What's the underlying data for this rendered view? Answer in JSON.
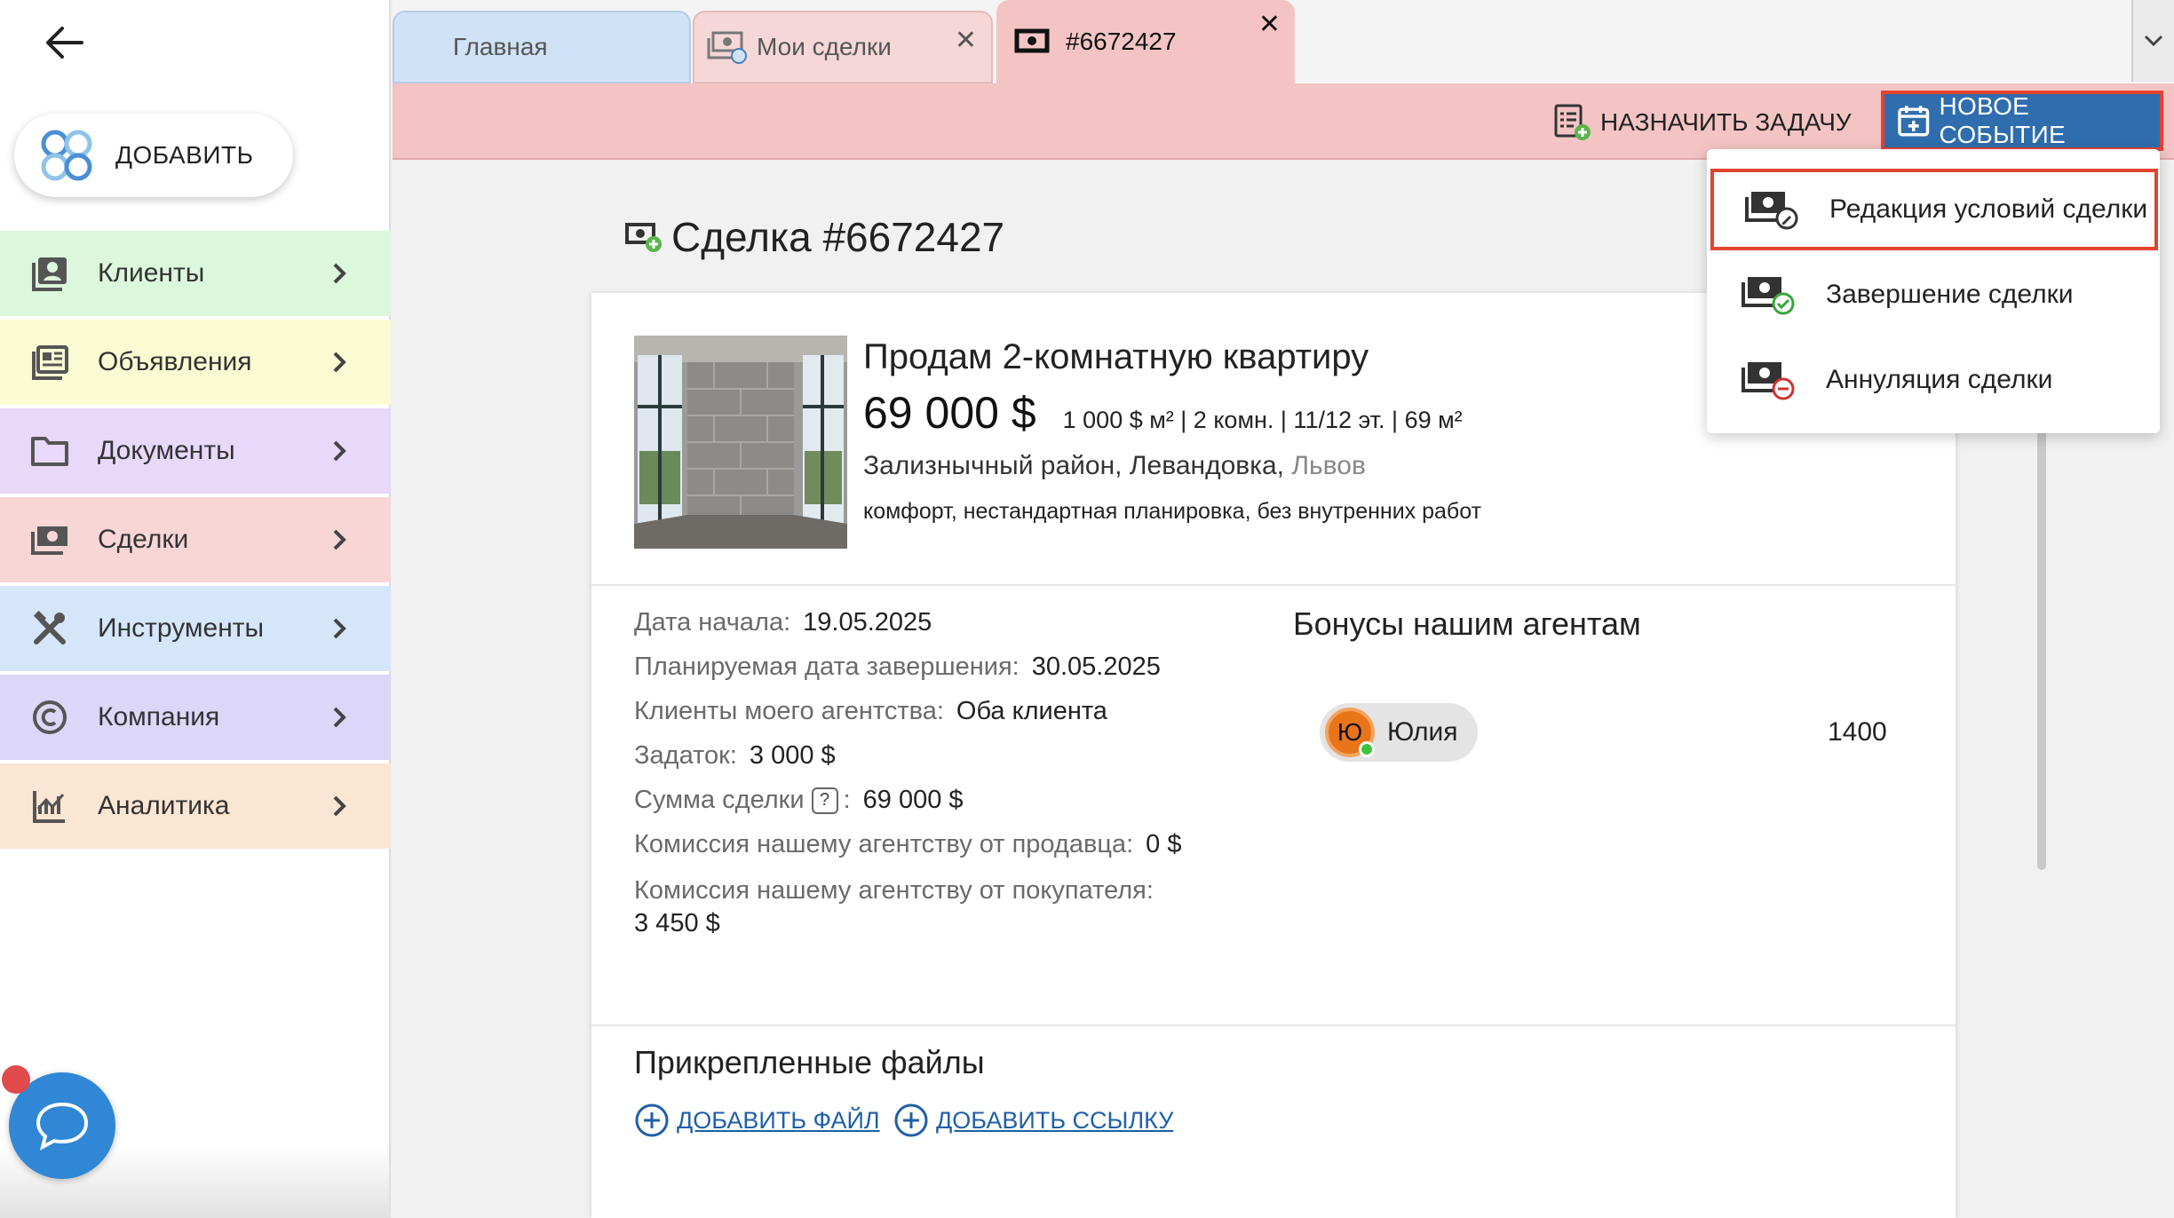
{
  "sidebar": {
    "add_label": "ДОБАВИТЬ",
    "items": [
      {
        "label": "Клиенты",
        "bg": "#dcf8dc",
        "icon": "clients-icon"
      },
      {
        "label": "Объявления",
        "bg": "#fbfbd3",
        "icon": "listings-icon"
      },
      {
        "label": "Документы",
        "bg": "#e8d8fa",
        "icon": "folder-icon"
      },
      {
        "label": "Сделки",
        "bg": "#f8d6d6",
        "icon": "deals-money-icon"
      },
      {
        "label": "Инструменты",
        "bg": "#d5e6fb",
        "icon": "tools-icon"
      },
      {
        "label": "Компания",
        "bg": "#dcd6f8",
        "icon": "copyright-icon"
      },
      {
        "label": "Аналитика",
        "bg": "#fbe5d3",
        "icon": "analytics-icon"
      }
    ]
  },
  "tabs": [
    {
      "label": "Главная"
    },
    {
      "label": "Мои сделки"
    },
    {
      "label": "#6672427"
    }
  ],
  "toolbar": {
    "assign_task": "НАЗНАЧИТЬ ЗАДАЧУ",
    "new_event": "НОВОЕ СОБЫТИЕ"
  },
  "menu": {
    "items": [
      {
        "label": "Редакция условий сделки",
        "icon": "edit-deal-icon"
      },
      {
        "label": "Завершение сделки",
        "icon": "complete-deal-icon"
      },
      {
        "label": "Аннуляция сделки",
        "icon": "cancel-deal-icon"
      }
    ]
  },
  "deal": {
    "title": "Сделка #6672427",
    "listing": {
      "title": "Продам 2-комнатную квартиру",
      "price": "69 000 $",
      "specs": "1 000 $ м² | 2 комн. | 11/12 эт. | 69 м²",
      "district": "Зализнычный район, Левандовка,",
      "city": "Львов",
      "features": "комфорт, нестандартная планировка, без внутренних работ"
    },
    "info": {
      "start_label": "Дата начала:",
      "start_value": "19.05.2025",
      "planned_label": "Планируемая дата завершения:",
      "planned_value": "30.05.2025",
      "clients_label": "Клиенты моего агентства:",
      "clients_value": "Оба клиента",
      "deposit_label": "Задаток:",
      "deposit_value": "3 000 $",
      "sum_label": "Сумма сделки",
      "sum_suffix": ":",
      "sum_help": "?",
      "sum_value": "69 000 $",
      "seller_comm_label": "Комиссия нашему агентству от продавца:",
      "seller_comm_value": "0 $",
      "buyer_comm_label": "Комиссия нашему агентству от покупателя:",
      "buyer_comm_value": "3 450 $"
    },
    "bonus": {
      "title": "Бонусы нашим агентам",
      "agent_initial": "Ю",
      "agent_name": "Юлия",
      "amount": "1400"
    },
    "files": {
      "title": "Прикрепленные файлы",
      "add_file": "ДОБАВИТЬ ФАЙЛ",
      "add_link": "ДОБАВИТЬ ССЫЛКУ"
    }
  },
  "colors": {
    "active_tab": "#f4c4c4",
    "new_event_btn": "#2f6dae",
    "highlight_border": "#e2442f",
    "link": "#1f5fa8"
  }
}
